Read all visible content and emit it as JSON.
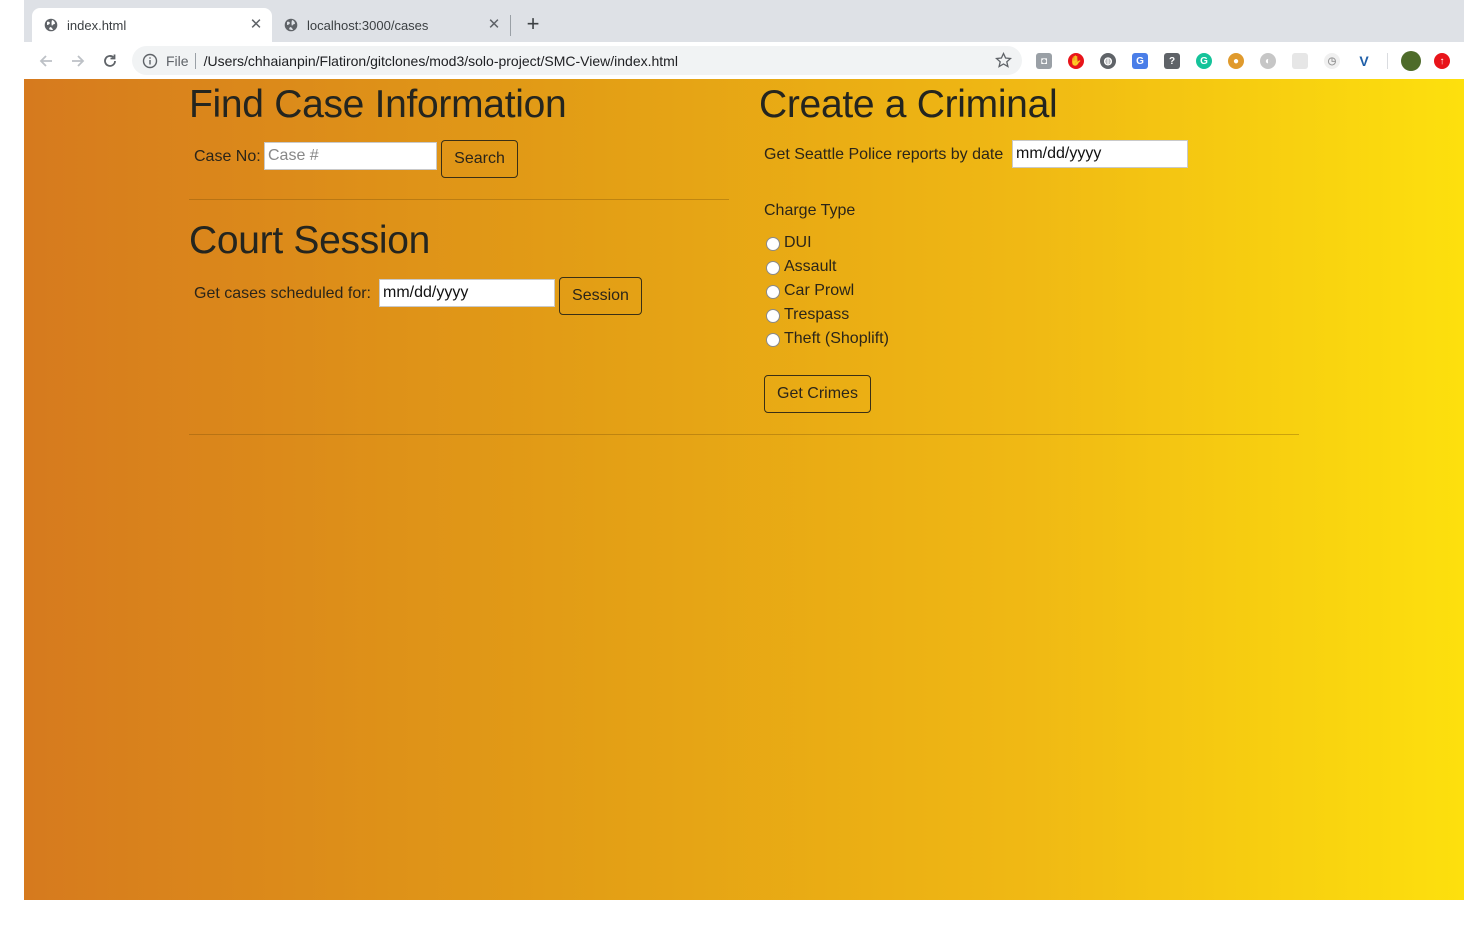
{
  "browser": {
    "tabs": [
      {
        "title": "index.html",
        "active": true
      },
      {
        "title": "localhost:3000/cases",
        "active": false
      }
    ],
    "address": {
      "scheme_label": "File",
      "url": "/Users/chhaianpin/Flatiron/gitclones/mod3/solo-project/SMC-View/index.html"
    },
    "extension_icons": [
      "camera-icon",
      "adblock-icon",
      "web-icon",
      "translate-icon",
      "help-icon",
      "grammarly-icon",
      "cookie-icon",
      "disable-icon",
      "blank-icon",
      "timer-icon",
      "vue-devtools-icon",
      "profile-avatar",
      "update-icon"
    ]
  },
  "find_case": {
    "heading": "Find Case Information",
    "label": "Case No:",
    "placeholder": "Case #",
    "button": "Search"
  },
  "court_session": {
    "heading": "Court Session",
    "label": "Get cases scheduled for:",
    "date_value": "mm/dd/yyyy",
    "button": "Session"
  },
  "create_criminal": {
    "heading": "Create a Criminal",
    "label": "Get Seattle Police reports by date",
    "date_value": "mm/dd/yyyy",
    "charge_label": "Charge Type",
    "charges": [
      "DUI",
      "Assault",
      "Car Prowl",
      "Trespass",
      "Theft (Shoplift)"
    ],
    "button": "Get Crimes"
  },
  "colors": {
    "gradient_start": "#d67a1e",
    "gradient_end": "#fde00d"
  }
}
